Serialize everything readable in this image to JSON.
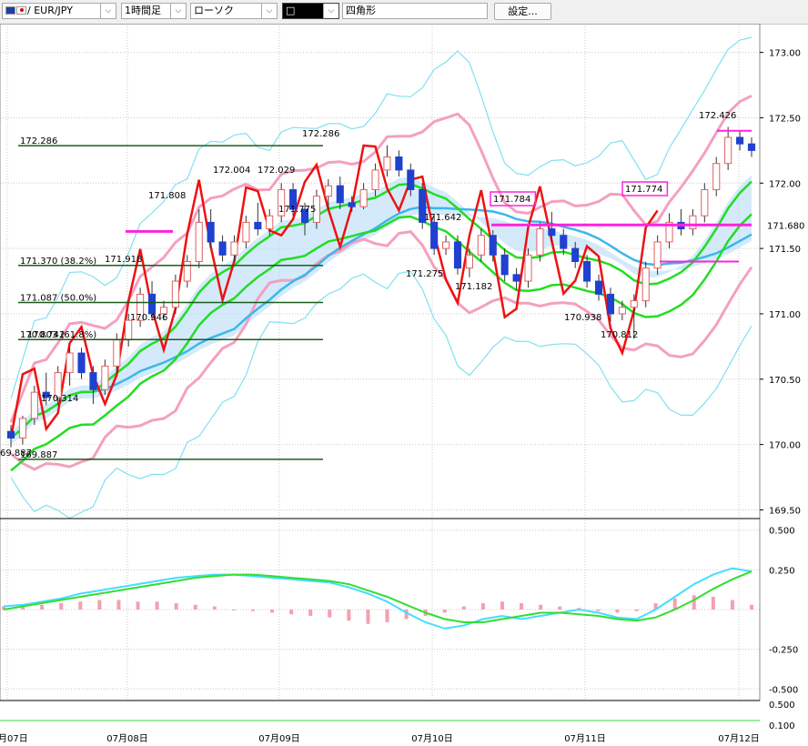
{
  "toolbar": {
    "symbol": "/ EUR/JPY",
    "timeframe": "1時間足",
    "chart_type": "ローソク",
    "drawing_tool": "□",
    "shape_name": "四角形",
    "settings_label": "設定..."
  },
  "colors": {
    "candle_up": "#e06060",
    "candle_down": "#2040d0",
    "ma_short": "#22dd22",
    "ma_long": "#3bb8e8",
    "bb": "#f4a0c0",
    "bb_outer": "#80e0f0",
    "chikou": "#ee1111",
    "line_marker": "#ff22dd",
    "fibo": "#1a5c1a",
    "macd": "#44ddff",
    "signal": "#33dd33",
    "hist": "#f4a0b0"
  },
  "chart_data": {
    "type": "candlestick",
    "title": "",
    "xlabel": "",
    "ylabel": "",
    "x_ticks": [
      "07月07日",
      "07月08日",
      "07月09日",
      "07月10日",
      "07月11日",
      "07月12日"
    ],
    "y_ticks": [
      169.5,
      170.0,
      170.5,
      171.0,
      171.5,
      172.0,
      172.5,
      173.0
    ],
    "y_tick_labels": [
      "169.50",
      "170.00",
      "170.50",
      "171.00",
      "171.50",
      "172.00",
      "172.50",
      "173.00"
    ],
    "ylim": [
      169.35,
      173.22
    ],
    "current_price": "171.680",
    "candles": [
      [
        170.1,
        170.15,
        169.98,
        170.05
      ],
      [
        170.05,
        170.22,
        170.0,
        170.2
      ],
      [
        170.2,
        170.45,
        170.15,
        170.4
      ],
      [
        170.4,
        170.55,
        170.3,
        170.36
      ],
      [
        170.36,
        170.6,
        170.3,
        170.55
      ],
      [
        170.55,
        170.75,
        170.45,
        170.7
      ],
      [
        170.7,
        170.74,
        170.5,
        170.55
      ],
      [
        170.55,
        170.6,
        170.31,
        170.42
      ],
      [
        170.42,
        170.65,
        170.38,
        170.6
      ],
      [
        170.6,
        170.85,
        170.55,
        170.8
      ],
      [
        170.8,
        171.0,
        170.75,
        170.95
      ],
      [
        170.95,
        171.2,
        170.9,
        171.15
      ],
      [
        171.15,
        171.25,
        170.95,
        171.0
      ],
      [
        171.0,
        171.1,
        170.95,
        171.05
      ],
      [
        171.05,
        171.3,
        171.0,
        171.25
      ],
      [
        171.25,
        171.45,
        171.2,
        171.4
      ],
      [
        171.4,
        171.8,
        171.35,
        171.7
      ],
      [
        171.7,
        171.8,
        171.5,
        171.55
      ],
      [
        171.55,
        171.6,
        171.4,
        171.45
      ],
      [
        171.45,
        171.6,
        171.4,
        171.55
      ],
      [
        171.55,
        171.75,
        171.5,
        171.7
      ],
      [
        171.7,
        171.85,
        171.6,
        171.65
      ],
      [
        171.65,
        171.8,
        171.6,
        171.75
      ],
      [
        171.75,
        172.0,
        171.7,
        171.95
      ],
      [
        171.95,
        172.0,
        171.75,
        171.8
      ],
      [
        171.8,
        171.85,
        171.6,
        171.7
      ],
      [
        171.7,
        171.95,
        171.65,
        171.9
      ],
      [
        171.9,
        172.03,
        171.8,
        171.98
      ],
      [
        171.98,
        172.05,
        171.8,
        171.85
      ],
      [
        171.85,
        171.9,
        171.78,
        171.82
      ],
      [
        171.82,
        172.0,
        171.8,
        171.95
      ],
      [
        171.95,
        172.15,
        171.9,
        172.1
      ],
      [
        172.1,
        172.29,
        172.05,
        172.2
      ],
      [
        172.2,
        172.25,
        172.05,
        172.1
      ],
      [
        172.1,
        172.15,
        171.9,
        171.95
      ],
      [
        171.95,
        172.0,
        171.65,
        171.7
      ],
      [
        171.7,
        171.75,
        171.45,
        171.5
      ],
      [
        171.5,
        171.6,
        171.45,
        171.55
      ],
      [
        171.55,
        171.6,
        171.3,
        171.35
      ],
      [
        171.35,
        171.5,
        171.28,
        171.45
      ],
      [
        171.45,
        171.65,
        171.4,
        171.6
      ],
      [
        171.6,
        171.64,
        171.4,
        171.45
      ],
      [
        171.45,
        171.5,
        171.25,
        171.3
      ],
      [
        171.3,
        171.35,
        171.18,
        171.25
      ],
      [
        171.25,
        171.5,
        171.2,
        171.45
      ],
      [
        171.45,
        171.7,
        171.4,
        171.65
      ],
      [
        171.65,
        171.78,
        171.55,
        171.6
      ],
      [
        171.6,
        171.65,
        171.45,
        171.5
      ],
      [
        171.5,
        171.55,
        171.35,
        171.4
      ],
      [
        171.4,
        171.45,
        171.2,
        171.25
      ],
      [
        171.25,
        171.3,
        171.1,
        171.15
      ],
      [
        171.15,
        171.2,
        170.94,
        171.0
      ],
      [
        171.0,
        171.1,
        170.95,
        171.05
      ],
      [
        171.05,
        171.15,
        170.81,
        171.1
      ],
      [
        171.1,
        171.4,
        171.05,
        171.35
      ],
      [
        171.35,
        171.6,
        171.3,
        171.55
      ],
      [
        171.55,
        171.77,
        171.5,
        171.7
      ],
      [
        171.7,
        171.8,
        171.6,
        171.65
      ],
      [
        171.65,
        171.8,
        171.6,
        171.75
      ],
      [
        171.75,
        172.0,
        171.7,
        171.95
      ],
      [
        171.95,
        172.2,
        171.9,
        172.15
      ],
      [
        172.15,
        172.43,
        172.1,
        172.35
      ],
      [
        172.35,
        172.4,
        172.25,
        172.3
      ],
      [
        172.3,
        172.35,
        172.2,
        172.25
      ]
    ],
    "price_labels": [
      "172.286",
      "172.004",
      "172.029",
      "171.808",
      "171.775",
      "171.918",
      "170.946",
      "170.742",
      "170.314",
      "69.887",
      "171.642",
      "171.275",
      "171.182",
      "171.784",
      "171.774",
      "170.938",
      "170.812",
      "172.426"
    ],
    "fibonacci": {
      "levels": [
        172.286,
        171.37,
        171.087,
        170.803,
        169.887
      ],
      "labels": [
        "172.286",
        "171.370 (38.2%)",
        "171.087 (50.0%)",
        "170.803 (61.8%)",
        "169.887"
      ]
    },
    "macd": {
      "y_ticks": [
        0.5,
        0.25,
        0.0,
        -0.25,
        -0.5
      ],
      "y_tick_labels": [
        "0.500",
        "0.250",
        "",
        "-0.250",
        "-0.500"
      ],
      "ylim": [
        -0.55,
        0.55
      ],
      "macd_line": [
        0.02,
        0.03,
        0.05,
        0.07,
        0.1,
        0.12,
        0.14,
        0.16,
        0.18,
        0.2,
        0.21,
        0.22,
        0.22,
        0.21,
        0.2,
        0.19,
        0.18,
        0.17,
        0.14,
        0.1,
        0.05,
        -0.02,
        -0.08,
        -0.12,
        -0.1,
        -0.06,
        -0.04,
        -0.06,
        -0.04,
        -0.02,
        0.0,
        -0.02,
        -0.05,
        -0.06,
        0.0,
        0.08,
        0.16,
        0.22,
        0.26,
        0.24
      ],
      "signal_line": [
        0.0,
        0.02,
        0.04,
        0.06,
        0.08,
        0.1,
        0.12,
        0.14,
        0.16,
        0.18,
        0.2,
        0.21,
        0.22,
        0.22,
        0.21,
        0.2,
        0.19,
        0.18,
        0.16,
        0.12,
        0.08,
        0.03,
        -0.02,
        -0.06,
        -0.08,
        -0.08,
        -0.06,
        -0.04,
        -0.02,
        -0.02,
        -0.03,
        -0.04,
        -0.06,
        -0.07,
        -0.05,
        0.0,
        0.06,
        0.13,
        0.19,
        0.24
      ],
      "histogram": [
        0.02,
        0.02,
        0.03,
        0.04,
        0.05,
        0.06,
        0.06,
        0.05,
        0.05,
        0.04,
        0.03,
        0.02,
        0.0,
        -0.01,
        -0.02,
        -0.03,
        -0.04,
        -0.05,
        -0.07,
        -0.09,
        -0.08,
        -0.06,
        -0.04,
        -0.02,
        0.02,
        0.04,
        0.05,
        0.04,
        0.03,
        0.02,
        0.01,
        -0.01,
        -0.02,
        -0.01,
        0.04,
        0.07,
        0.09,
        0.08,
        0.06,
        0.03
      ]
    },
    "bottom_panel": {
      "y_tick_labels": [
        "0.500",
        "0.100"
      ]
    }
  }
}
